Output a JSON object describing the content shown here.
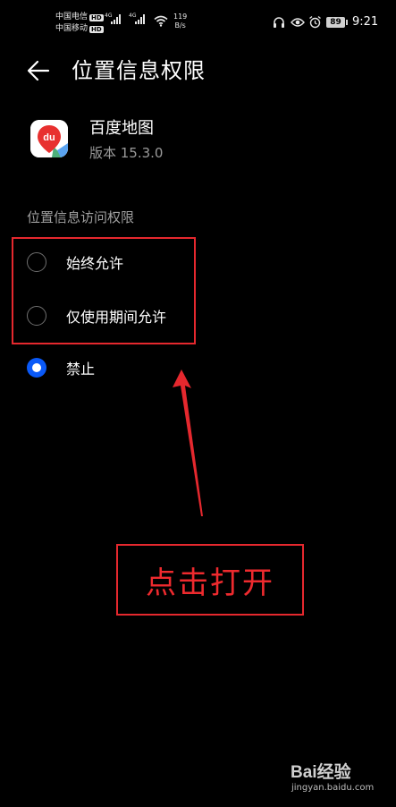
{
  "status_bar": {
    "carrier_1": "中国电信",
    "carrier_2": "中国移动",
    "hd_label": "HD",
    "network_1": "4G",
    "network_2": "4G",
    "speed_value": "119",
    "speed_unit": "B/s",
    "battery": "89",
    "time": "9:21",
    "icons": [
      "headset-icon",
      "eye-icon",
      "alarm-icon"
    ]
  },
  "header": {
    "title": "位置信息权限"
  },
  "app": {
    "icon_text": "du",
    "name": "百度地图",
    "version": "版本 15.3.0"
  },
  "section": {
    "label": "位置信息访问权限"
  },
  "options": [
    {
      "label": "始终允许",
      "selected": false
    },
    {
      "label": "仅使用期间允许",
      "selected": false
    },
    {
      "label": "禁止",
      "selected": true
    }
  ],
  "annotation": {
    "callout": "点击打开",
    "color": "#e5282e"
  },
  "watermark": {
    "brand": "Bai经验",
    "url": "jingyan.baidu.com"
  },
  "colors": {
    "background": "#000000",
    "accent": "#0a59f7",
    "secondary_text": "#9a9a9a"
  }
}
